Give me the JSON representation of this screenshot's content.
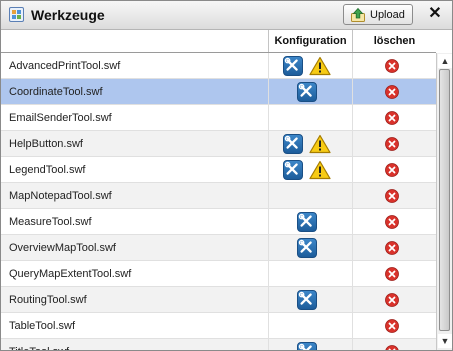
{
  "window": {
    "title": "Werkzeuge",
    "upload_label": "Upload",
    "close_glyph": "✕"
  },
  "columns": {
    "config": "Konfiguration",
    "delete": "löschen"
  },
  "colors": {
    "selected_row": "#aec6ee",
    "tool_icon": "#2a70b4",
    "warning": "#f2c200",
    "delete": "#d9322b"
  },
  "icons": {
    "configure": "wrench-screwdriver-icon",
    "warning": "warning-icon",
    "delete": "delete-icon",
    "upload": "upload-icon"
  },
  "rows": [
    {
      "name": "AdvancedPrintTool.swf",
      "configurable": true,
      "warning": true,
      "selected": false
    },
    {
      "name": "CoordinateTool.swf",
      "configurable": true,
      "warning": false,
      "selected": true
    },
    {
      "name": "EmailSenderTool.swf",
      "configurable": false,
      "warning": false,
      "selected": false
    },
    {
      "name": "HelpButton.swf",
      "configurable": true,
      "warning": true,
      "selected": false
    },
    {
      "name": "LegendTool.swf",
      "configurable": true,
      "warning": true,
      "selected": false
    },
    {
      "name": "MapNotepadTool.swf",
      "configurable": false,
      "warning": false,
      "selected": false
    },
    {
      "name": "MeasureTool.swf",
      "configurable": true,
      "warning": false,
      "selected": false
    },
    {
      "name": "OverviewMapTool.swf",
      "configurable": true,
      "warning": false,
      "selected": false
    },
    {
      "name": "QueryMapExtentTool.swf",
      "configurable": false,
      "warning": false,
      "selected": false
    },
    {
      "name": "RoutingTool.swf",
      "configurable": true,
      "warning": false,
      "selected": false
    },
    {
      "name": "TableTool.swf",
      "configurable": false,
      "warning": false,
      "selected": false
    },
    {
      "name": "TitleTool.swf",
      "configurable": true,
      "warning": false,
      "selected": false
    }
  ]
}
